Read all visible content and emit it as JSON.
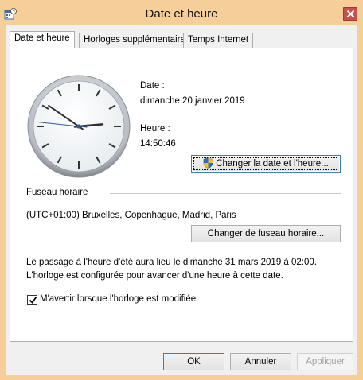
{
  "window": {
    "title": "Date et heure",
    "app_icon": "date-time-icon",
    "close_icon": "close-icon"
  },
  "tabs": [
    {
      "label": "Date et heure",
      "active": true
    },
    {
      "label": "Horloges supplémentaires",
      "active": false
    },
    {
      "label": "Temps Internet",
      "active": false
    }
  ],
  "clock": {
    "hour": 14,
    "minute": 50,
    "second": 46
  },
  "date_section": {
    "date_label": "Date :",
    "date_value": "dimanche 20 janvier 2019",
    "time_label": "Heure :",
    "time_value": "14:50:46",
    "change_button": "Changer la date et l'heure..."
  },
  "timezone_section": {
    "heading": "Fuseau horaire",
    "value": "(UTC+01:00) Bruxelles, Copenhague, Madrid, Paris",
    "change_button": "Changer de fuseau horaire..."
  },
  "dst_notice": {
    "line1": "Le passage à l'heure d'été aura lieu le dimanche 31 mars 2019 à 02:00.",
    "line2": "L'horloge est configurée pour avancer d'une heure à cette date."
  },
  "notify_checkbox": {
    "label": "M'avertir lorsque l'horloge est modifiée",
    "checked": true
  },
  "footer": {
    "ok": "OK",
    "cancel": "Annuler",
    "apply": "Appliquer"
  }
}
